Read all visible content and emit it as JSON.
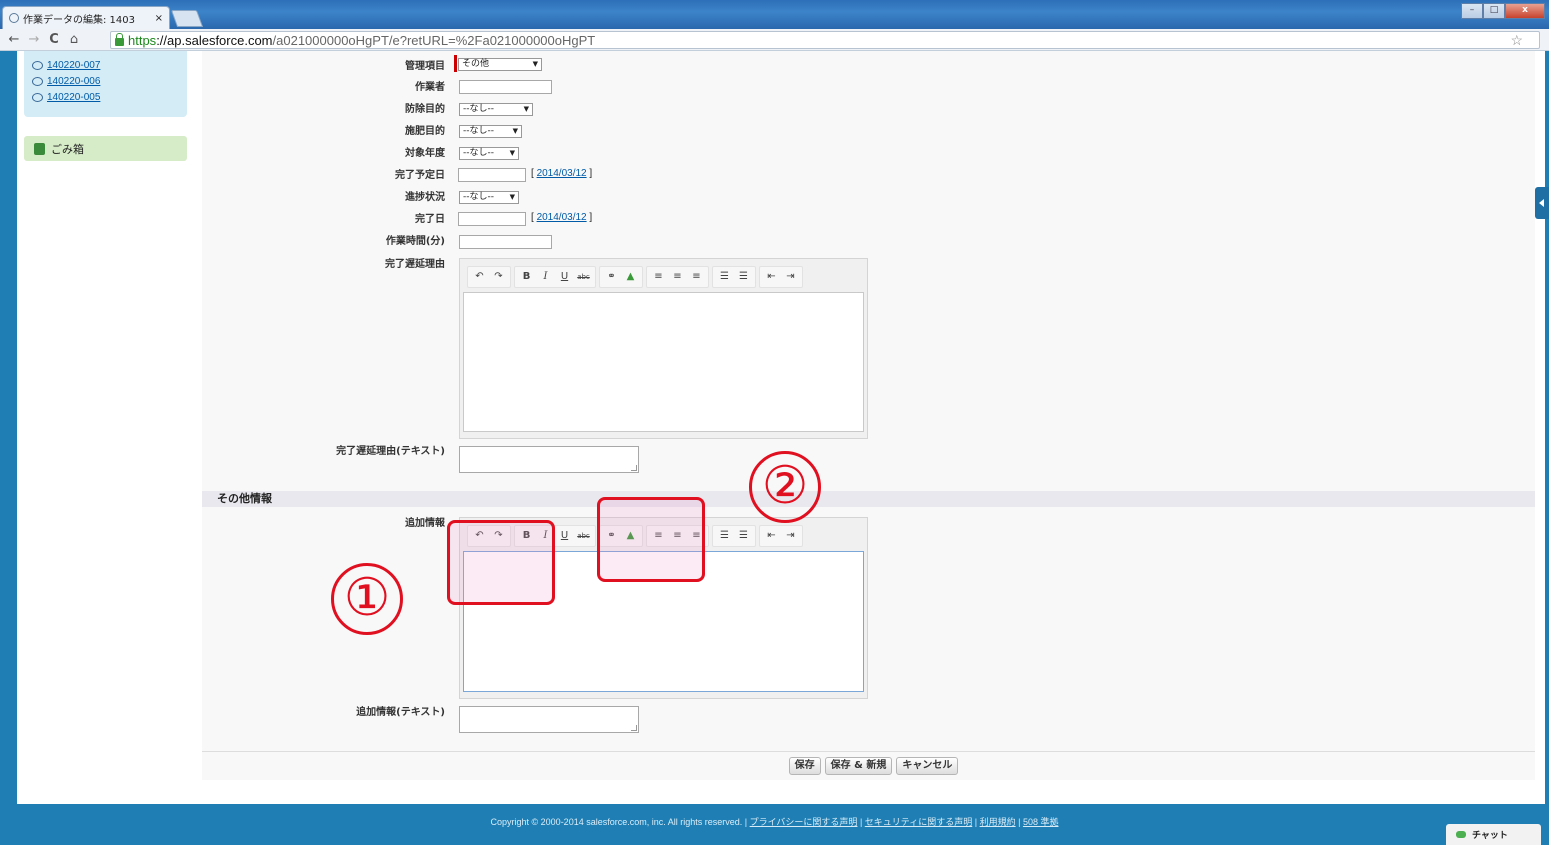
{
  "browser": {
    "tab_title": "作業データの編集: 1403",
    "tab_close": "×",
    "url_scheme": "https",
    "url_host": "://ap.salesforce.com",
    "url_path": "/a021000000oHgPT/e?retURL=%2Fa021000000oHgPT",
    "star": "☆",
    "nav_back": "←",
    "nav_forward": "→",
    "reload": "C",
    "home": "⌂",
    "win_minimize": "–",
    "win_maximize": "□",
    "win_close": "x"
  },
  "sidebar": {
    "recent_items": [
      "140220-007",
      "140220-006",
      "140220-005"
    ],
    "trash_label": "ごみ箱"
  },
  "form": {
    "fields": {
      "kanri_label": "管理項目",
      "kanri_value": "その他",
      "worker_label": "作業者",
      "boujo_label": "防除目的",
      "boujo_value": "--なし--",
      "sehi_label": "施肥目的",
      "sehi_value": "--なし--",
      "nendo_label": "対象年度",
      "nendo_value": "--なし--",
      "yotei_label": "完了予定日",
      "yotei_date_link": "2014/03/12",
      "shinchoku_label": "進捗状況",
      "shinchoku_value": "--なし--",
      "kanryo_label": "完了日",
      "kanryo_date_link": "2014/03/12",
      "jikan_label": "作業時間(分)",
      "chien_label": "完了遅延理由",
      "chien_text_label": "完了遅延理由(テキスト)"
    },
    "section_title": "その他情報",
    "tsuika_label": "追加情報",
    "tsuika_text_label": "追加情報(テキスト)",
    "bracket_open": "[",
    "bracket_close": "]"
  },
  "editor_toolbar": {
    "undo": "↶",
    "redo": "↷",
    "bold": "B",
    "italic": "I",
    "underline": "U",
    "strike": "abc",
    "link": "⚭",
    "image": "▲",
    "align_left": "≡",
    "align_center": "≡",
    "align_right": "≡",
    "bullet_list": "☰",
    "number_list": "☰",
    "outdent": "⇤",
    "indent": "⇥"
  },
  "buttons": {
    "save": "保存",
    "save_new": "保存 & 新規",
    "cancel": "キャンセル"
  },
  "annotations": {
    "marker1": "①",
    "marker2": "②"
  },
  "footer": {
    "copyright": "Copyright © 2000-2014 salesforce.com, inc. All rights reserved. | ",
    "privacy": "プライバシーに関する声明",
    "security": "セキュリティに関する声明",
    "terms": "利用規約",
    "accessibility": "508 準拠",
    "sep": " | "
  },
  "chat_label": "チャット",
  "colors": {
    "highlight_red": "#e01020",
    "brand_blue": "#1f7fb4"
  }
}
